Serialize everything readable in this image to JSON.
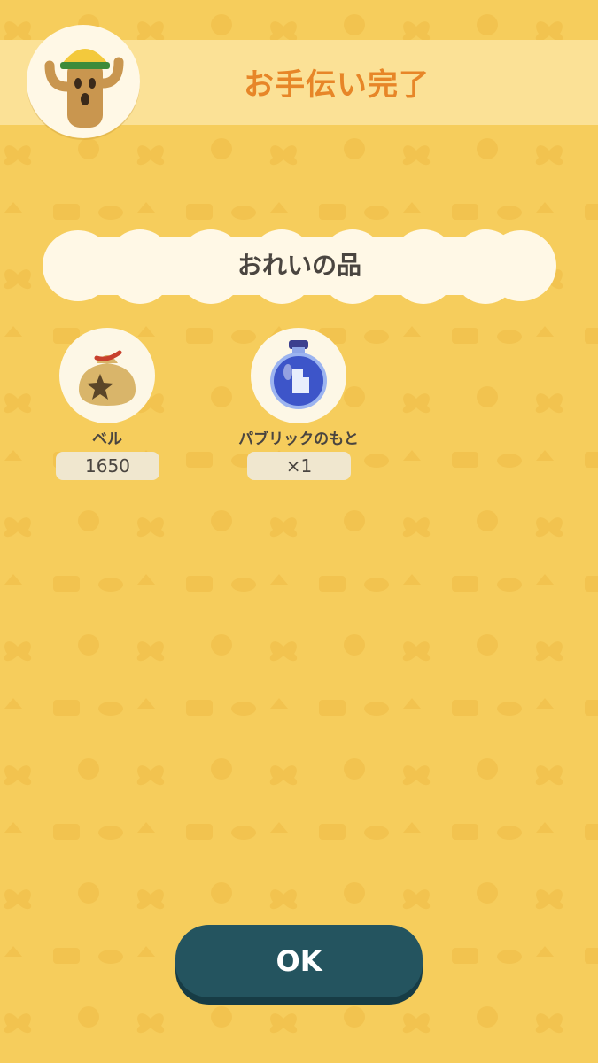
{
  "header": {
    "title": "お手伝い完了",
    "avatar_icon": "cactus-villager-helmet-icon"
  },
  "rewards": {
    "heading": "おれいの品",
    "items": [
      {
        "name": "ベル",
        "quantity": "1650",
        "icon": "bell-bag-icon"
      },
      {
        "name": "パブリックのもと",
        "quantity": "×1",
        "icon": "public-essence-bottle-icon"
      }
    ]
  },
  "actions": {
    "ok_label": "OK"
  },
  "colors": {
    "background": "#f6cd5c",
    "header_band": "#fbe196",
    "title_text": "#e78628",
    "ok_button": "#24545f"
  }
}
